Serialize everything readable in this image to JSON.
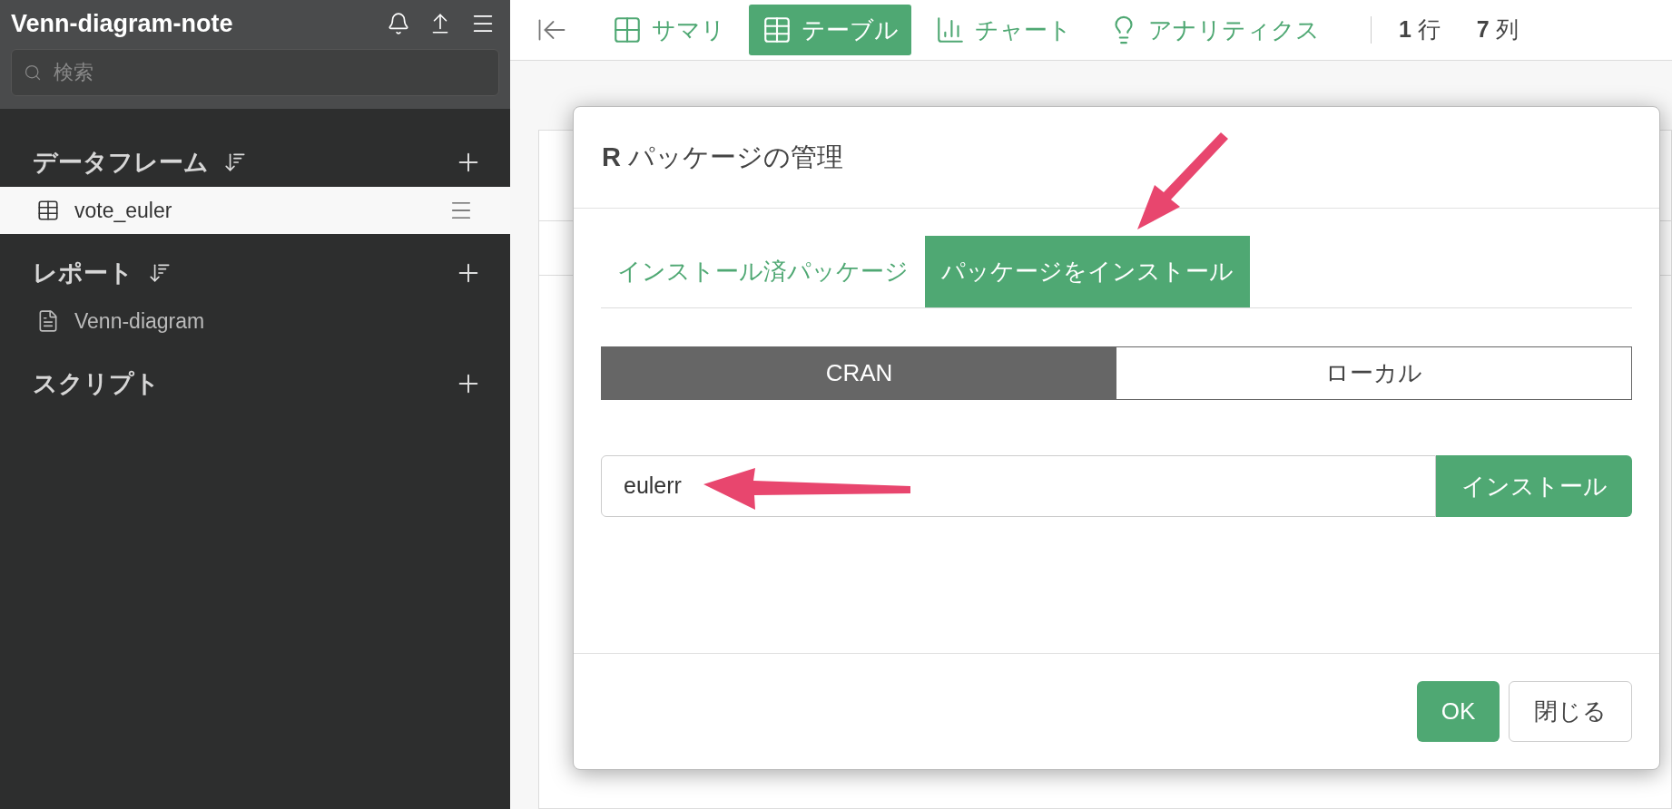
{
  "sidebar": {
    "title": "Venn-diagram-note",
    "search": {
      "placeholder": "検索"
    },
    "sections": [
      {
        "title": "データフレーム",
        "sortable": true,
        "items": [
          {
            "kind": "table",
            "label": "vote_euler",
            "selected": true
          }
        ]
      },
      {
        "title": "レポート",
        "sortable": true,
        "items": [
          {
            "kind": "report",
            "label": "Venn-diagram",
            "selected": false
          }
        ]
      },
      {
        "title": "スクリプト",
        "sortable": false
      }
    ]
  },
  "toolbar": {
    "views": [
      {
        "kind": "summary",
        "label": "サマリ",
        "selected": false
      },
      {
        "kind": "table",
        "label": "テーブル",
        "selected": true
      },
      {
        "kind": "chart",
        "label": "チャート",
        "selected": false
      },
      {
        "kind": "analytics",
        "label": "アナリティクス",
        "selected": false
      }
    ],
    "counts": [
      {
        "value": "1",
        "unit": "行"
      },
      {
        "value": "7",
        "unit": "列"
      }
    ]
  },
  "dialog": {
    "title": "**R** パッケージの管理",
    "tabs": [
      {
        "label": "インストール済パッケージ",
        "selected": false
      },
      {
        "label": "パッケージをインストール",
        "selected": true
      }
    ],
    "sources": [
      {
        "label": "CRAN",
        "selected": true
      },
      {
        "label": "ローカル",
        "selected": false
      }
    ],
    "package_field": {
      "value": "eulerr"
    },
    "install_button": "インストール",
    "buttons": [
      {
        "kind": "primary",
        "label": "OK"
      },
      {
        "kind": "secondary",
        "label": "閉じる"
      }
    ]
  }
}
